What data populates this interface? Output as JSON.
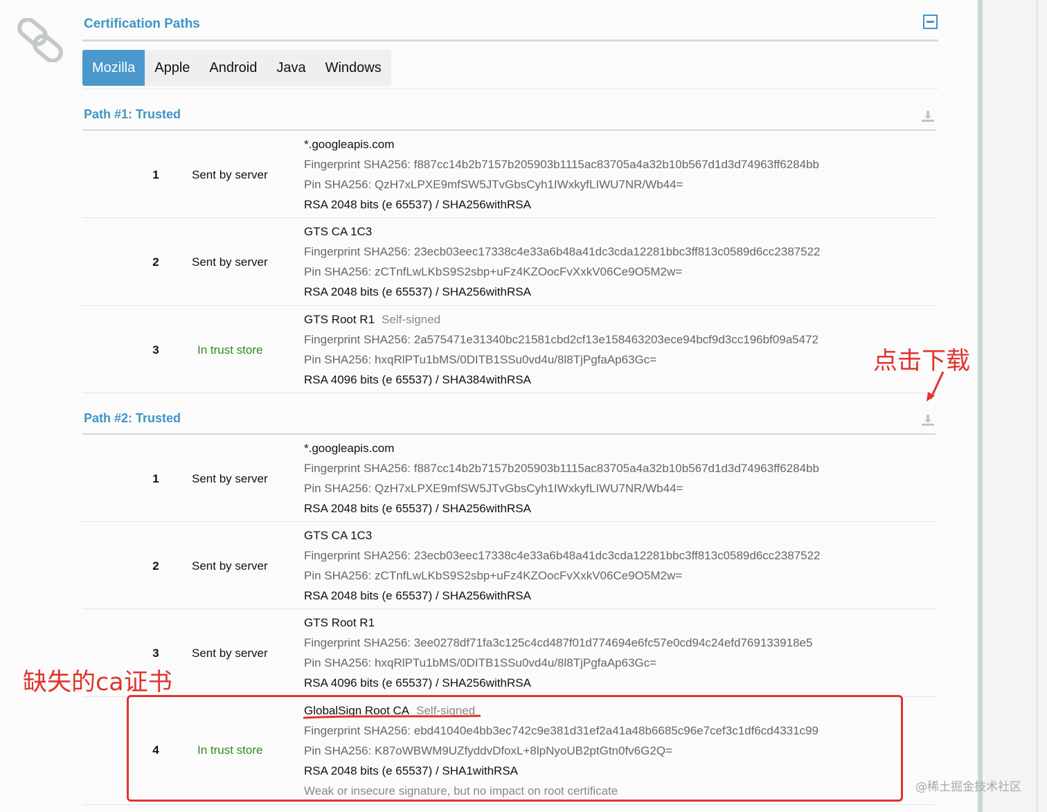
{
  "section": {
    "title": "Certification Paths",
    "collapse_icon": "collapse-icon",
    "chain_icon": "link-chain-icon"
  },
  "tabs": [
    {
      "label": "Mozilla",
      "active": true
    },
    {
      "label": "Apple",
      "active": false
    },
    {
      "label": "Android",
      "active": false
    },
    {
      "label": "Java",
      "active": false
    },
    {
      "label": "Windows",
      "active": false
    }
  ],
  "colors": {
    "accent": "#3f94c8",
    "active_tab": "#4a98cc",
    "trust_green": "#2e8b1c",
    "annotation_red": "#e0342c"
  },
  "paths": [
    {
      "header": "Path #1: Trusted",
      "download_icon": "download-icon",
      "certs": [
        {
          "num": "1",
          "status": "Sent by server",
          "name": "*.googleapis.com",
          "self_signed": "",
          "fingerprint": "Fingerprint SHA256: f887cc14b2b7157b205903b1115ac83705a4a32b10b567d1d3d74963ff6284bb",
          "pin": "Pin SHA256: QzH7xLPXE9mfSW5JTvGbsCyh1IWxkyfLIWU7NR/Wb44=",
          "key": "RSA 2048 bits (e 65537) / SHA256withRSA",
          "note": ""
        },
        {
          "num": "2",
          "status": "Sent by server",
          "name": "GTS CA 1C3",
          "self_signed": "",
          "fingerprint": "Fingerprint SHA256: 23ecb03eec17338c4e33a6b48a41dc3cda12281bbc3ff813c0589d6cc2387522",
          "pin": "Pin SHA256: zCTnfLwLKbS9S2sbp+uFz4KZOocFvXxkV06Ce9O5M2w=",
          "key": "RSA 2048 bits (e 65537) / SHA256withRSA",
          "note": ""
        },
        {
          "num": "3",
          "status": "In trust store",
          "name": "GTS Root R1",
          "self_signed": "Self-signed",
          "fingerprint": "Fingerprint SHA256: 2a575471e31340bc21581cbd2cf13e158463203ece94bcf9d3cc196bf09a5472",
          "pin": "Pin SHA256: hxqRlPTu1bMS/0DITB1SSu0vd4u/8l8TjPgfaAp63Gc=",
          "key": "RSA 4096 bits (e 65537) / SHA384withRSA",
          "note": ""
        }
      ]
    },
    {
      "header": "Path #2: Trusted",
      "download_icon": "download-icon",
      "certs": [
        {
          "num": "1",
          "status": "Sent by server",
          "name": "*.googleapis.com",
          "self_signed": "",
          "fingerprint": "Fingerprint SHA256: f887cc14b2b7157b205903b1115ac83705a4a32b10b567d1d3d74963ff6284bb",
          "pin": "Pin SHA256: QzH7xLPXE9mfSW5JTvGbsCyh1IWxkyfLIWU7NR/Wb44=",
          "key": "RSA 2048 bits (e 65537) / SHA256withRSA",
          "note": ""
        },
        {
          "num": "2",
          "status": "Sent by server",
          "name": "GTS CA 1C3",
          "self_signed": "",
          "fingerprint": "Fingerprint SHA256: 23ecb03eec17338c4e33a6b48a41dc3cda12281bbc3ff813c0589d6cc2387522",
          "pin": "Pin SHA256: zCTnfLwLKbS9S2sbp+uFz4KZOocFvXxkV06Ce9O5M2w=",
          "key": "RSA 2048 bits (e 65537) / SHA256withRSA",
          "note": ""
        },
        {
          "num": "3",
          "status": "Sent by server",
          "name": "GTS Root R1",
          "self_signed": "",
          "fingerprint": "Fingerprint SHA256: 3ee0278df71fa3c125c4cd487f01d774694e6fc57e0cd94c24efd769133918e5",
          "pin": "Pin SHA256: hxqRlPTu1bMS/0DITB1SSu0vd4u/8l8TjPgfaAp63Gc=",
          "key": "RSA 4096 bits (e 65537) / SHA256withRSA",
          "note": ""
        },
        {
          "num": "4",
          "status": "In trust store",
          "name": "GlobalSign Root CA",
          "self_signed": "Self-signed",
          "fingerprint": "Fingerprint SHA256: ebd41040e4bb3ec742c9e381d31ef2a41a48b6685c96e7cef3c1df6cd4331c99",
          "pin": "Pin SHA256: K87oWBWM9UZfyddvDfoxL+8lpNyoUB2ptGtn0fv6G2Q=",
          "key": "RSA 2048 bits (e 65537) / SHA1withRSA",
          "note": "Weak or insecure signature, but no impact on root certificate"
        }
      ]
    }
  ],
  "annotations": {
    "click_download": "点击下载",
    "missing_ca": "缺失的ca证书"
  },
  "watermark": "@稀土掘金技术社区"
}
